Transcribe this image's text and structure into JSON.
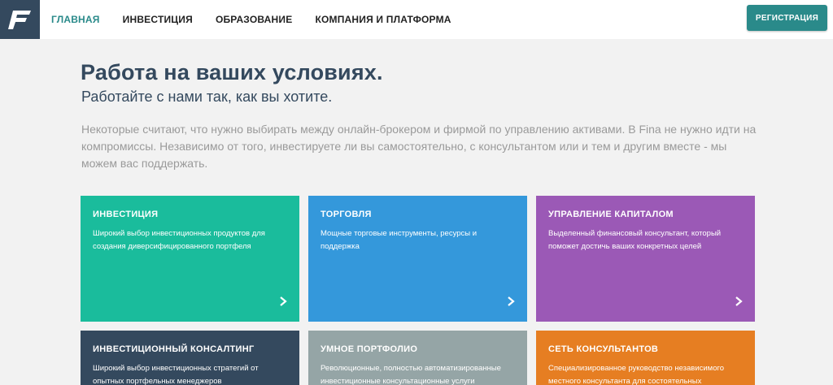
{
  "header": {
    "logo_letter": "F",
    "nav": [
      {
        "label": "ГЛАВНАЯ",
        "active": true
      },
      {
        "label": "ИНВЕСТИЦИЯ",
        "active": false
      },
      {
        "label": "ОБРАЗОВАНИЕ",
        "active": false
      },
      {
        "label": "КОМПАНИЯ И ПЛАТФОРМА",
        "active": false
      }
    ],
    "register_label": "РЕГИСТРАЦИЯ"
  },
  "hero": {
    "title": "Работа на ваших условиях.",
    "subtitle": "Работайте с нами так, как вы хотите.",
    "text": "Некоторые считают, что нужно выбирать между онлайн-брокером и фирмой по управлению активами. В Fina не нужно идти на компромиссы. Независимо от того, инвестируете ли вы самостоятельно, с консультантом или и тем и другим вместе - мы можем вас поддержать."
  },
  "cards": [
    {
      "title": "ИНВЕСТИЦИЯ",
      "text": "Широкий выбор инвестиционных продуктов для создания диверсифицированного портфеля",
      "color": "#1abc9c"
    },
    {
      "title": "ТОРГОВЛЯ",
      "text": "Мощные торговые инструменты, ресурсы и поддержка",
      "color": "#3498db"
    },
    {
      "title": "УПРАВЛЕНИЕ КАПИТАЛОМ",
      "text": "Выделенный финансовый консультант, который поможет достичь ваших конкретных целей",
      "color": "#9b59b6"
    },
    {
      "title": "ИНВЕСТИЦИОННЫЙ КОНСАЛТИНГ",
      "text": "Широкий выбор инвестиционных стратегий от опытных портфельных менеджеров",
      "color": "#34495e"
    },
    {
      "title": "УМНОЕ ПОРТФОЛИО",
      "text": "Революционные, полностью автоматизированные инвестиционные консультационные услуги",
      "color": "#95a5a6"
    },
    {
      "title": "СЕТЬ КОНСУЛЬТАНТОВ",
      "text": "Специализированное руководство независимого местного консультанта для состоятельных",
      "color": "#e67e22"
    }
  ],
  "colors": {
    "accent": "#2a8a8a",
    "heading": "#34495e",
    "muted_text": "#9a9a9a",
    "background": "#f2f2f2"
  },
  "icons": {
    "logo": "fina-logo",
    "card_arrow": "chevron-right-icon"
  }
}
